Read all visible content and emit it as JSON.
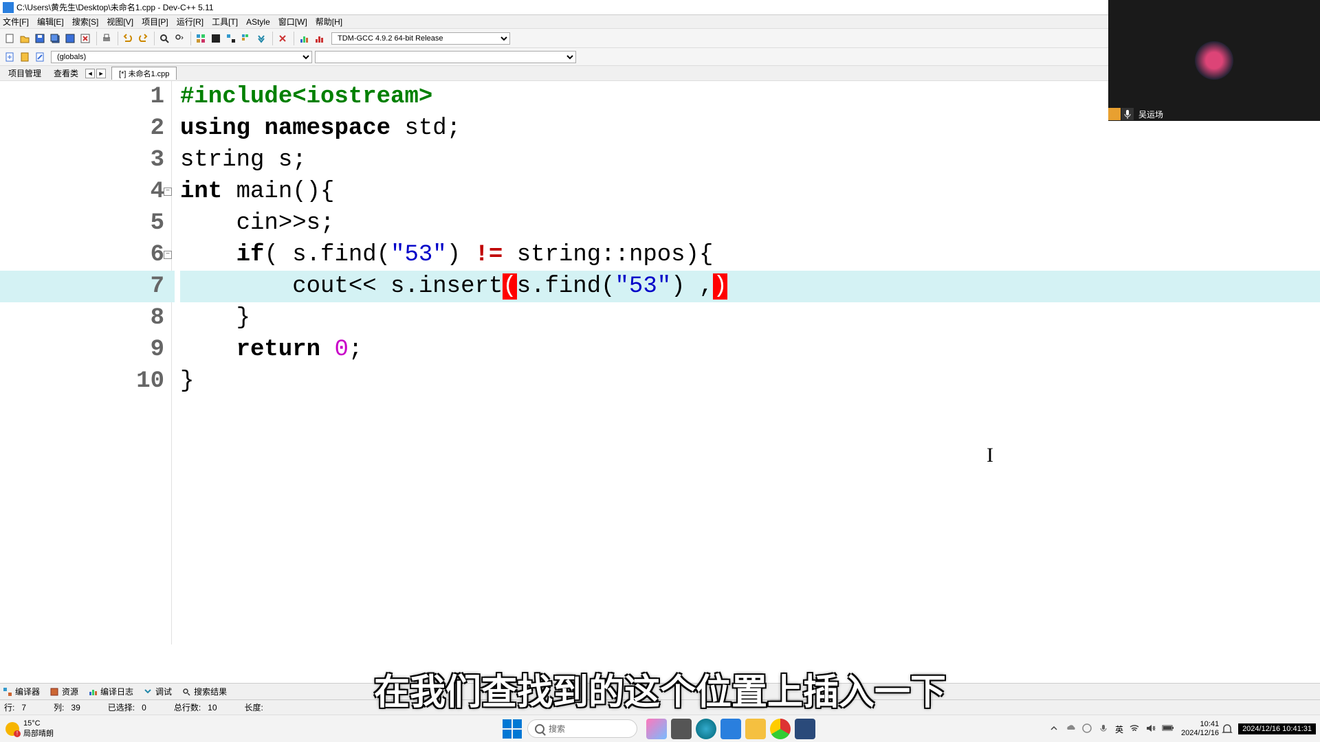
{
  "window": {
    "title": "C:\\Users\\黄先生\\Desktop\\未命名1.cpp - Dev-C++ 5.11"
  },
  "menu": {
    "file": "文件[F]",
    "edit": "编辑[E]",
    "search": "搜索[S]",
    "view": "视图[V]",
    "project": "项目[P]",
    "run": "运行[R]",
    "tools": "工具[T]",
    "astyle": "AStyle",
    "window": "窗口[W]",
    "help": "帮助[H]"
  },
  "toolbar": {
    "compiler": "TDM-GCC 4.9.2 64-bit Release"
  },
  "toolbar2": {
    "globals": "(globals)"
  },
  "sidebar": {
    "tab_project": "项目管理",
    "tab_classes": "查看类",
    "file_tab": "[*] 未命名1.cpp"
  },
  "code": {
    "l1": "#include<iostream>",
    "l2_kw1": "using",
    "l2_kw2": "namespace",
    "l2_id": " std;",
    "l3": "string s;",
    "l4_kw": "int",
    "l4_rest": " main(){",
    "l5": "    cin>>s;",
    "l6_a": "    ",
    "l6_if": "if",
    "l6_b": "( s.find(",
    "l6_str": "\"53\"",
    "l6_c": ") ",
    "l6_op": "!=",
    "l6_d": " string::npos){",
    "l7_a": "        cout<< s.insert",
    "l7_p1": "(",
    "l7_b": "s.find(",
    "l7_str": "\"53\"",
    "l7_c": ") ,",
    "l7_p2": ")",
    "l8": "    }",
    "l9_a": "    ",
    "l9_kw": "return",
    "l9_b": " ",
    "l9_num": "0",
    "l9_c": ";",
    "l10": "}",
    "ln": {
      "1": "1",
      "2": "2",
      "3": "3",
      "4": "4",
      "5": "5",
      "6": "6",
      "7": "7",
      "8": "8",
      "9": "9",
      "10": "10"
    }
  },
  "bottom_tabs": {
    "compiler": "编译器",
    "resources": "资源",
    "compile_log": "编译日志",
    "debug": "调试",
    "search_results": "搜索结果"
  },
  "status": {
    "line_lbl": "行:",
    "line_val": "7",
    "col_lbl": "列:",
    "col_val": "39",
    "sel_lbl": "已选择:",
    "sel_val": "0",
    "total_lbl": "总行数:",
    "total_val": "10",
    "len_lbl": "长度:"
  },
  "subtitle": "在我们查找到的这个位置上插入一下",
  "overlay": {
    "speaker": "吴运场"
  },
  "taskbar": {
    "temp": "15°C",
    "weather": "局部晴朗",
    "search_placeholder": "搜索",
    "ime": "英",
    "time": "10:41",
    "date": "2024/12/16",
    "datetime_full": "2024/12/16 10:41:31"
  }
}
